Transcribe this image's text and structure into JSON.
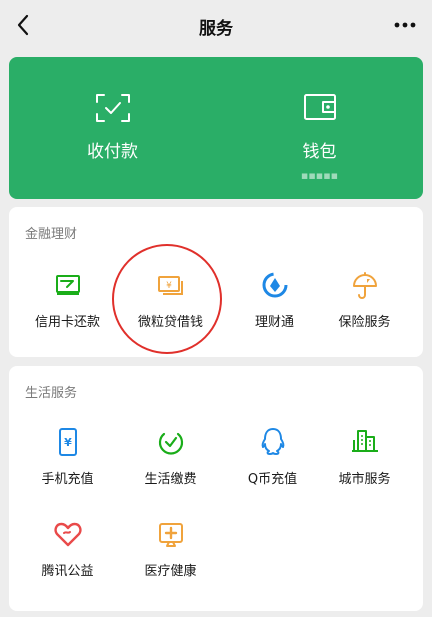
{
  "header": {
    "title": "服务"
  },
  "hero": {
    "items": [
      {
        "label": "收付款",
        "icon": "scan-payment-icon"
      },
      {
        "label": "钱包",
        "icon": "wallet-icon"
      }
    ],
    "wallet_sub": "▪▪▪▪▪"
  },
  "finance": {
    "title": "金融理财",
    "items": [
      {
        "label": "信用卡还款",
        "icon": "credit-card-icon"
      },
      {
        "label": "微粒贷借钱",
        "icon": "loan-icon"
      },
      {
        "label": "理财通",
        "icon": "wealth-icon"
      },
      {
        "label": "保险服务",
        "icon": "insurance-icon"
      }
    ]
  },
  "life": {
    "title": "生活服务",
    "items": [
      {
        "label": "手机充值",
        "icon": "phone-topup-icon"
      },
      {
        "label": "生活缴费",
        "icon": "utility-bill-icon"
      },
      {
        "label": "Q币充值",
        "icon": "qq-coin-icon"
      },
      {
        "label": "城市服务",
        "icon": "city-service-icon"
      },
      {
        "label": "腾讯公益",
        "icon": "charity-icon"
      },
      {
        "label": "医疗健康",
        "icon": "medical-icon"
      }
    ]
  },
  "colors": {
    "brand_green": "#2aae67",
    "annotation_red": "#e0302b",
    "page_bg": "#ededed"
  }
}
